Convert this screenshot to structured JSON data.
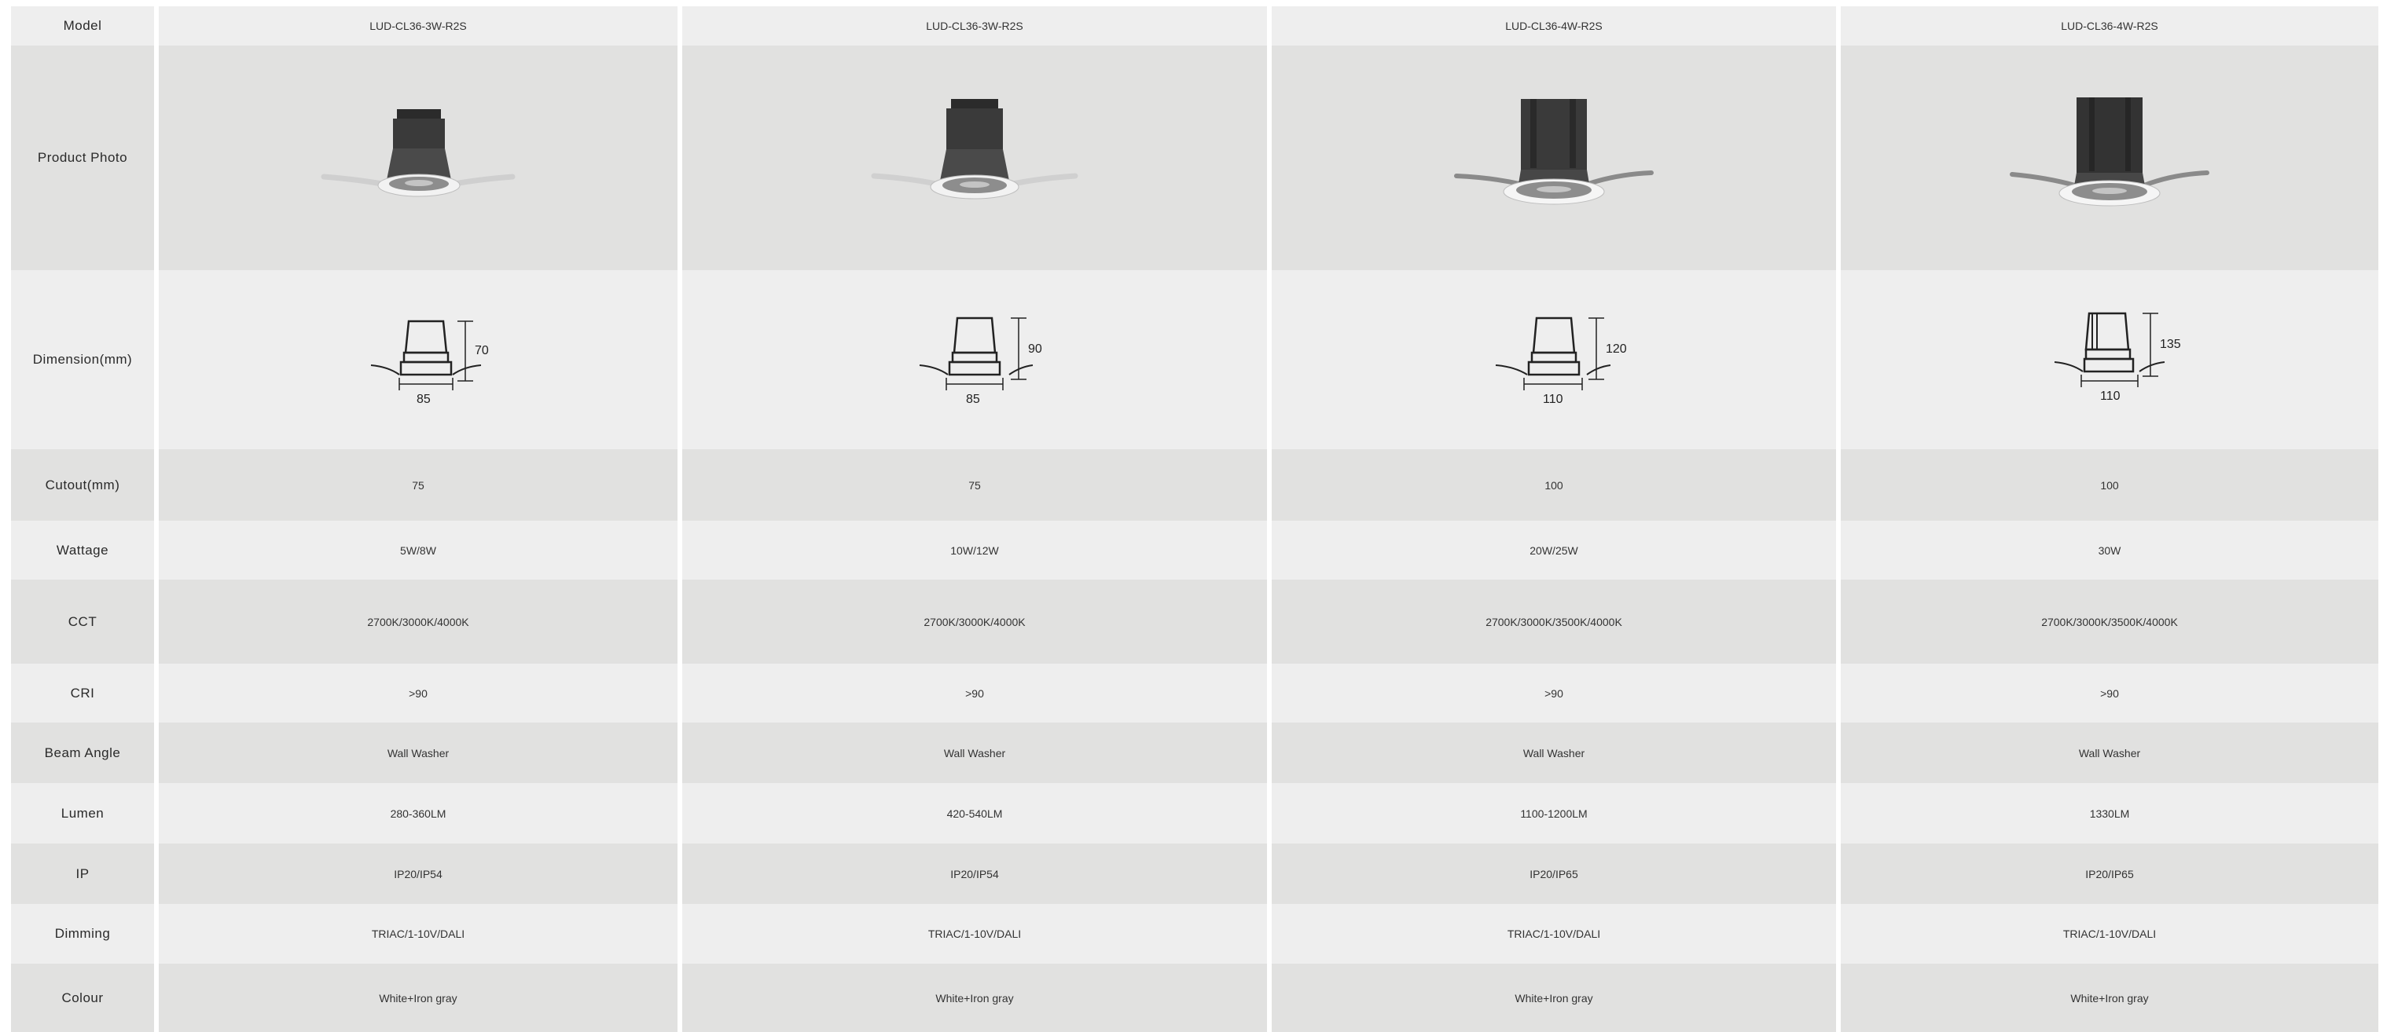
{
  "labels": {
    "model": "Model",
    "photo": "Product  Photo",
    "dimension": "Dimension(mm)",
    "cutout": "Cutout(mm)",
    "wattage": "Wattage",
    "cct": "CCT",
    "cri": "CRI",
    "beam": "Beam Angle",
    "lumen": "Lumen",
    "ip": "IP",
    "dimming": "Dimming",
    "colour": "Colour"
  },
  "products": [
    {
      "model": "LUD-CL36-3W-R2S",
      "width": "85",
      "height": "70",
      "cutout": "75",
      "wattage": "5W/8W",
      "cct": "2700K/3000K/4000K",
      "cri": ">90",
      "beam": "Wall Washer",
      "lumen": "280-360LM",
      "ip": "IP20/IP54",
      "dimming": "TRIAC/1-10V/DALI",
      "colour": "White+Iron gray"
    },
    {
      "model": "LUD-CL36-3W-R2S",
      "width": "85",
      "height": "90",
      "cutout": "75",
      "wattage": "10W/12W",
      "cct": "2700K/3000K/4000K",
      "cri": ">90",
      "beam": "Wall Washer",
      "lumen": "420-540LM",
      "ip": "IP20/IP54",
      "dimming": "TRIAC/1-10V/DALI",
      "colour": "White+Iron gray"
    },
    {
      "model": "LUD-CL36-4W-R2S",
      "width": "110",
      "height": "120",
      "cutout": "100",
      "wattage": "20W/25W",
      "cct": "2700K/3000K/3500K/4000K",
      "cri": ">90",
      "beam": "Wall Washer",
      "lumen": "1100-1200LM",
      "ip": "IP20/IP65",
      "dimming": "TRIAC/1-10V/DALI",
      "colour": "White+Iron gray"
    },
    {
      "model": "LUD-CL36-4W-R2S",
      "width": "110",
      "height": "135",
      "cutout": "100",
      "wattage": "30W",
      "cct": "2700K/3000K/3500K/4000K",
      "cri": ">90",
      "beam": "Wall Washer",
      "lumen": "1330LM",
      "ip": "IP20/IP65",
      "dimming": "TRIAC/1-10V/DALI",
      "colour": "White+Iron gray"
    }
  ]
}
